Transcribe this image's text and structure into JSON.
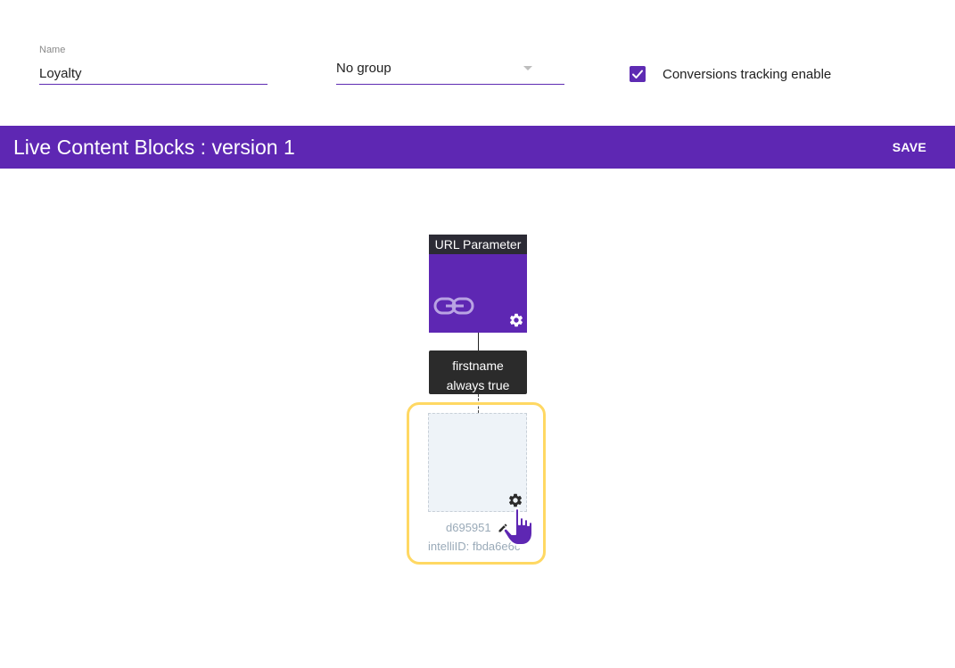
{
  "form": {
    "name_label": "Name",
    "name_value": "Loyalty",
    "group_value": "No group",
    "conversions_label": "Conversions tracking enable",
    "conversions_checked": true
  },
  "header": {
    "title": "Live Content Blocks : version 1",
    "save_label": "SAVE"
  },
  "diagram": {
    "url_node": {
      "title": "URL Parameter"
    },
    "condition": {
      "line1": "firstname",
      "line2": "always true"
    },
    "empty_block": {
      "id": "d695951",
      "intelli_id": "intelliID: fbda6e6c"
    }
  },
  "colors": {
    "accent": "#5e27b3",
    "highlight": "#ffd863",
    "node_title_bg": "#2c2b35"
  },
  "icons": [
    "checkmark-icon",
    "chevron-down-icon",
    "link-icon",
    "gear-icon",
    "pencil-icon",
    "hand-cursor-icon"
  ]
}
